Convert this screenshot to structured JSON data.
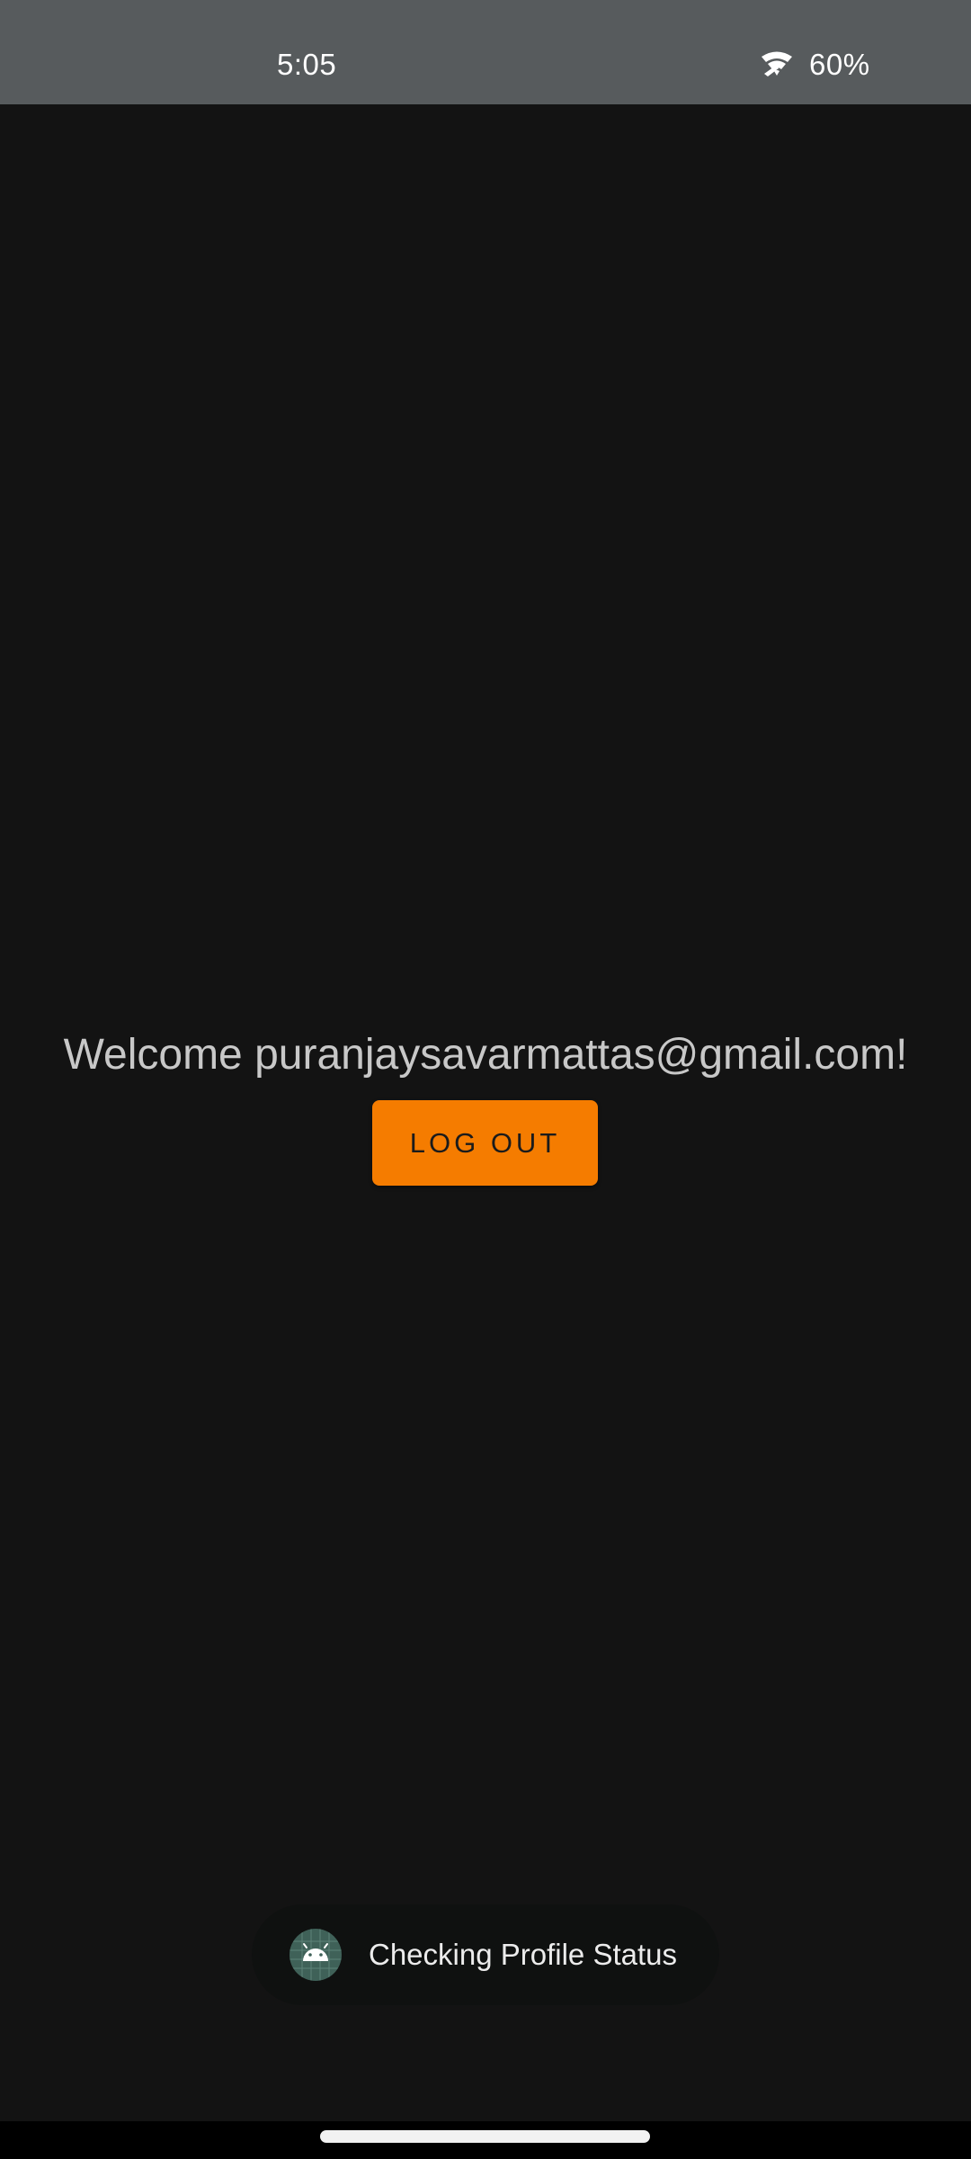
{
  "status_bar": {
    "time": "5:05",
    "battery": "60%",
    "wifi_icon": "wifi-icon"
  },
  "main": {
    "welcome": "Welcome puranjaysavarmattas@gmail.com!",
    "logout_label": "LOG OUT"
  },
  "toast": {
    "icon": "android-icon",
    "message": "Checking Profile Status"
  },
  "colors": {
    "status_bar_bg": "#575b5d",
    "background": "#131313",
    "accent": "#f57c00"
  }
}
